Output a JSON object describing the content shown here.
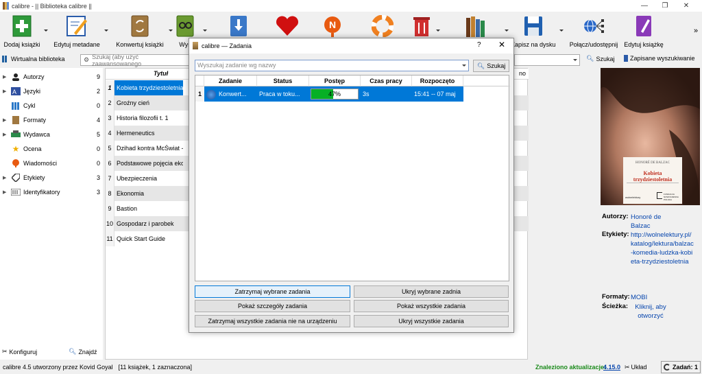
{
  "window": {
    "title": "calibre - || Biblioteka calibre ||",
    "controls": [
      "—",
      "❐",
      "✕"
    ]
  },
  "toolbar": {
    "items": [
      {
        "label": "Dodaj książki",
        "icon": "add-book-icon"
      },
      {
        "label": "Edytuj metadane",
        "icon": "edit-metadata-icon"
      },
      {
        "label": "Konwertuj książki",
        "icon": "convert-icon"
      },
      {
        "label": "Wyś",
        "icon": "view-icon"
      },
      {
        "label": "",
        "icon": "download-icon"
      },
      {
        "label": "",
        "icon": "heart-icon"
      },
      {
        "label": "",
        "icon": "news-icon"
      },
      {
        "label": "",
        "icon": "help-icon"
      },
      {
        "label": "",
        "icon": "trash-icon"
      },
      {
        "label": "",
        "icon": "library-icon"
      },
      {
        "label": "Zapisz na dysku",
        "icon": "save-icon"
      },
      {
        "label": "Połącz/udostępnij",
        "icon": "connect-share-icon"
      },
      {
        "label": "Edytuj książkę",
        "icon": "edit-book-icon"
      }
    ],
    "more": "»"
  },
  "searchbar": {
    "virtual_library": "Wirtualna biblioteka",
    "placeholder": "Szukaj (aby użyć zaawansowanego",
    "search_button": "Szukaj",
    "saved_searches": "Zapisane wyszukiwanie"
  },
  "tag_browser": {
    "items": [
      {
        "label": "Autorzy",
        "count": "9",
        "expandable": true,
        "icon": "authors-icon"
      },
      {
        "label": "Języki",
        "count": "2",
        "expandable": true,
        "icon": "languages-icon"
      },
      {
        "label": "Cykl",
        "count": "0",
        "expandable": false,
        "icon": "series-icon"
      },
      {
        "label": "Formaty",
        "count": "4",
        "expandable": true,
        "icon": "formats-icon"
      },
      {
        "label": "Wydawca",
        "count": "5",
        "expandable": true,
        "icon": "publisher-icon"
      },
      {
        "label": "Ocena",
        "count": "0",
        "expandable": false,
        "icon": "rating-star-icon"
      },
      {
        "label": "Wiadomości",
        "count": "0",
        "expandable": false,
        "icon": "news-tag-icon"
      },
      {
        "label": "Etykiety",
        "count": "3",
        "expandable": true,
        "icon": "tags-icon"
      },
      {
        "label": "Identyfikatory",
        "count": "3",
        "expandable": true,
        "icon": "identifiers-icon"
      }
    ],
    "configure": "Konfiguruj",
    "find": "Znajdź"
  },
  "book_list": {
    "header": {
      "title": "Tytuł",
      "right_fragment": "no"
    },
    "rows": [
      {
        "num": "1",
        "title": "Kobieta trzydziestoletnia",
        "selected": true
      },
      {
        "num": "2",
        "title": "Groźny cień"
      },
      {
        "num": "3",
        "title": "Historia filozofii t. 1"
      },
      {
        "num": "4",
        "title": "Hermeneutics"
      },
      {
        "num": "5",
        "title": "Dzihad kontra McŚwiat - fr"
      },
      {
        "num": "6",
        "title": "Podstawowe pojęcia ekono"
      },
      {
        "num": "7",
        "title": "Ubezpieczenia"
      },
      {
        "num": "8",
        "title": "Ekonomia"
      },
      {
        "num": "9",
        "title": "Bastion"
      },
      {
        "num": "10",
        "title": "Gospodarz i parobek"
      },
      {
        "num": "11",
        "title": "Quick Start Guide"
      }
    ]
  },
  "book_details": {
    "cover": {
      "author": "HONORÉ DE BALZAC",
      "title_line1": "Kobieta",
      "title_line2": "trzydziestoletnia",
      "publisher_left": "wolnelektury",
      "publisher_right": "FUNDACJA NOWOCZESNA POLSKA"
    },
    "authors_label": "Autorzy:",
    "authors_value": "Honoré de Balzac",
    "tags_label": "Etykiety:",
    "tags_value": "http://wolnelektury.pl/katalog/lektura/balzac-komedia-ludzka-kobieta-trzydziestoletnia",
    "formats_label": "Formaty:",
    "formats_value": "MOBI",
    "path_label": "Ścieżka:",
    "path_value": "Kliknij, aby otworzyć"
  },
  "statusbar": {
    "left": "calibre 4.5 utworzony przez Kovid Goyal",
    "count": "[11 książek, 1 zaznaczona]",
    "update_label": "Znaleziono aktualizacje:",
    "update_version": "4.15.0",
    "layout": "Układ",
    "jobs": "Zadań: 1"
  },
  "jobs_dialog": {
    "title": "calibre — Zadania",
    "help": "?",
    "close": "✕",
    "search_placeholder": "Wyszukaj zadanie wg nazwy",
    "search_button": "Szukaj",
    "columns": [
      "Zadanie",
      "Status",
      "Postęp",
      "Czas pracy",
      "Rozpoczęto"
    ],
    "job": {
      "num": "1",
      "name": "Konwert...",
      "status": "Praca w toku...",
      "progress_text": "47%",
      "progress": 0.47,
      "runtime": "3s",
      "started": "15:41 -- 07 maj"
    },
    "buttons": {
      "stop_selected": "Zatrzymaj wybrane zadania",
      "hide_selected": "Ukryj wybrane zadnia",
      "show_details": "Pokaż szczegóły zadania",
      "show_all": "Pokaż wszystkie zadania",
      "stop_all_non_device": "Zatrzymaj wszystkie zadania nie na urządzeniu",
      "hide_all": "Ukryj wszystkie zadania"
    }
  },
  "colors": {
    "selection": "#0078d7",
    "progress": "#06b025",
    "link": "#0645ad",
    "update_green": "#1a8a1a"
  }
}
